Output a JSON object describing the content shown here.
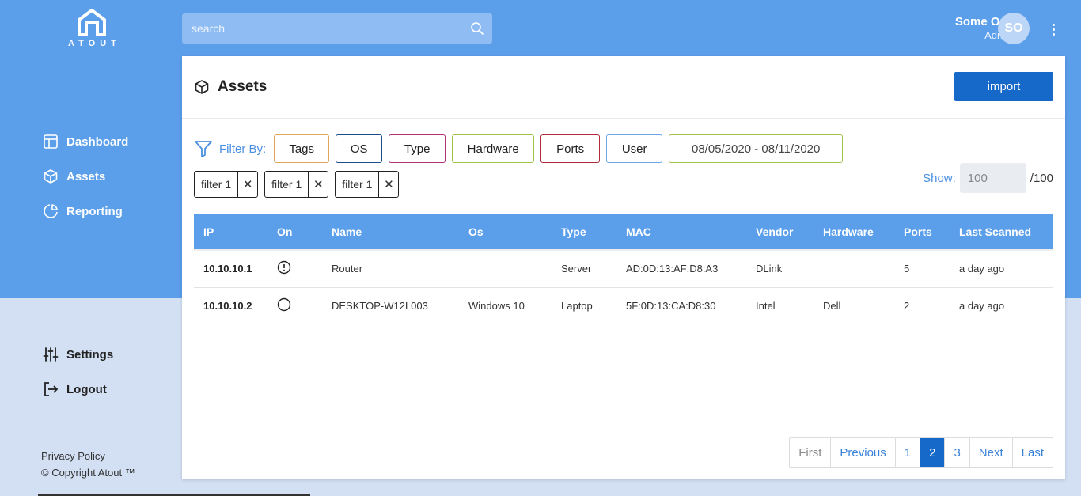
{
  "app": {
    "logo_text": "ATOUT"
  },
  "search": {
    "placeholder": "search"
  },
  "user": {
    "name": "Some One",
    "role": "Admin",
    "initials": "SO"
  },
  "sidebar": {
    "items": [
      {
        "label": "Dashboard",
        "icon": "layout-icon"
      },
      {
        "label": "Assets",
        "icon": "cube-icon"
      },
      {
        "label": "Reporting",
        "icon": "pie-chart-icon"
      }
    ],
    "settings_label": "Settings",
    "logout_label": "Logout",
    "privacy_label": "Privacy Policy",
    "copyright": "© Copyright Atout ™"
  },
  "page": {
    "title": "Assets",
    "import_label": "import"
  },
  "filters": {
    "label": "Filter By:",
    "chips": [
      {
        "label": "Tags",
        "color": "#e0a45a"
      },
      {
        "label": "OS",
        "color": "#1b4f8a"
      },
      {
        "label": "Type",
        "color": "#b0307a"
      },
      {
        "label": "Hardware",
        "color": "#9ec24a"
      },
      {
        "label": "Ports",
        "color": "#b02a3a"
      },
      {
        "label": "User",
        "color": "#6aa6e8"
      }
    ],
    "date_range": {
      "label": "08/05/2020 - 08/11/2020",
      "color": "#9ec24a"
    },
    "active": [
      "filter 1",
      "filter 1",
      "filter 1"
    ]
  },
  "show": {
    "label": "Show:",
    "value": "100",
    "total": "/100"
  },
  "table": {
    "columns": [
      "IP",
      "On",
      "Name",
      "Os",
      "Type",
      "MAC",
      "Vendor",
      "Hardware",
      "Ports",
      "Last Scanned"
    ],
    "rows": [
      {
        "ip": "10.10.10.1",
        "status": "warning",
        "name": "Router",
        "os": "",
        "type": "Server",
        "mac": "AD:0D:13:AF:D8:A3",
        "vendor": "DLink",
        "hardware": "",
        "ports": "5",
        "last_scanned": "a day ago"
      },
      {
        "ip": "10.10.10.2",
        "status": "offline",
        "name": "DESKTOP-W12L003",
        "os": "Windows 10",
        "type": "Laptop",
        "mac": "5F:0D:13:CA:D8:30",
        "vendor": "Intel",
        "hardware": "Dell",
        "ports": "2",
        "last_scanned": "a day ago"
      }
    ]
  },
  "pagination": {
    "first": "First",
    "previous": "Previous",
    "pages": [
      "1",
      "2",
      "3"
    ],
    "current": "2",
    "next": "Next",
    "last": "Last"
  },
  "colors": {
    "brand": "#5b9eea",
    "accent": "#1769c9",
    "background": "#d3e0f4"
  }
}
